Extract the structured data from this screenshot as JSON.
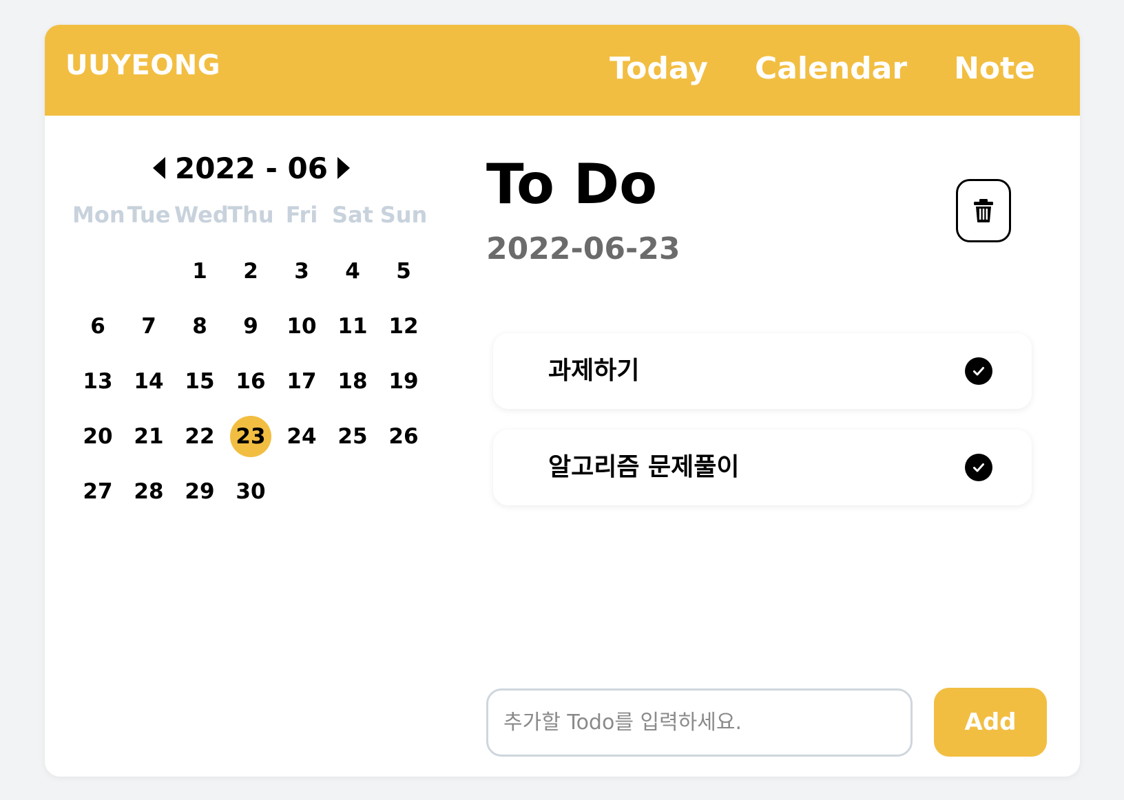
{
  "header": {
    "logo": "UUYEONG",
    "nav": [
      "Today",
      "Calendar",
      "Note"
    ]
  },
  "calendar": {
    "month_label": "2022 - 06",
    "weekdays": [
      "Mon",
      "Tue",
      "Wed",
      "Thu",
      "Fri",
      "Sat",
      "Sun"
    ],
    "leading_blanks": 2,
    "days": [
      "1",
      "2",
      "3",
      "4",
      "5",
      "6",
      "7",
      "8",
      "9",
      "10",
      "11",
      "12",
      "13",
      "14",
      "15",
      "16",
      "17",
      "18",
      "19",
      "20",
      "21",
      "22",
      "23",
      "24",
      "25",
      "26",
      "27",
      "28",
      "29",
      "30"
    ],
    "selected_day": "23"
  },
  "todo": {
    "title": "To Do",
    "date": "2022-06-23",
    "items": [
      {
        "text": "과제하기",
        "done": true
      },
      {
        "text": "알고리즘 문제풀이",
        "done": true
      }
    ],
    "input_placeholder": "추가할 Todo를 입력하세요.",
    "add_label": "Add"
  },
  "colors": {
    "accent": "#f2be42",
    "weekday": "#c8d2dc",
    "date_gray": "#6b6b6b"
  },
  "icons": {
    "prev_month": "caret-left-icon",
    "next_month": "caret-right-icon",
    "trash": "trash-icon",
    "check": "check-circle-icon"
  }
}
